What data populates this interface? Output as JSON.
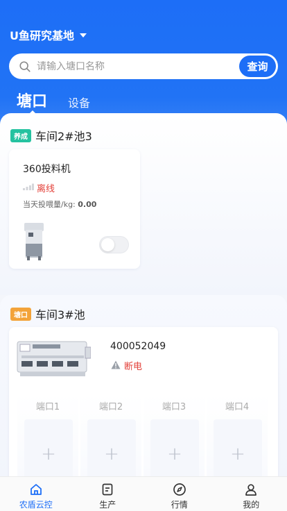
{
  "header": {
    "base_name": "U鱼研究基地",
    "search_placeholder": "请输入塘口名称",
    "search_button": "查询"
  },
  "tabs": [
    {
      "label": "塘口",
      "active": true
    },
    {
      "label": "设备",
      "active": false
    }
  ],
  "sections": [
    {
      "badge": "养成",
      "badge_color": "#25c2a0",
      "title": "车间2#池3",
      "device": {
        "name": "360投料机",
        "status": "离线",
        "feed_label": "当天投喂量/kg:",
        "feed_value": "0.00",
        "switch_on": false
      }
    },
    {
      "badge": "塘口",
      "badge_color": "#f3a33a",
      "title": "车间3#池",
      "controller": {
        "id": "400052049",
        "status": "断电",
        "ports": [
          "端口1",
          "端口2",
          "端口3",
          "端口4"
        ],
        "add_symbol": "+"
      }
    }
  ],
  "tabbar": [
    {
      "label": "农盾云控",
      "icon": "home-icon",
      "active": true
    },
    {
      "label": "生产",
      "icon": "document-icon",
      "active": false
    },
    {
      "label": "行情",
      "icon": "compass-icon",
      "active": false
    },
    {
      "label": "我的",
      "icon": "user-icon",
      "active": false
    }
  ],
  "colors": {
    "primary": "#1d6ef7",
    "danger": "#e3413a"
  }
}
